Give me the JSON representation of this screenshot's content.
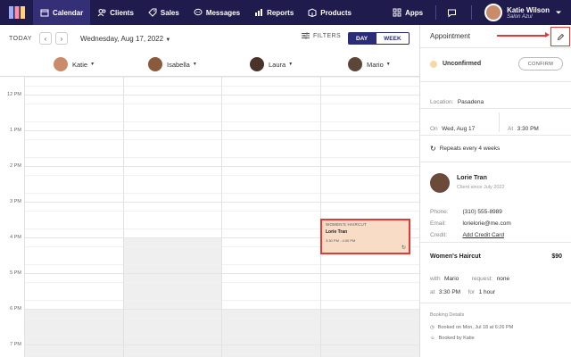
{
  "nav": {
    "items": [
      {
        "label": "Calendar",
        "icon": "calendar-icon"
      },
      {
        "label": "Clients",
        "icon": "clients-icon"
      },
      {
        "label": "Sales",
        "icon": "tag-icon"
      },
      {
        "label": "Messages",
        "icon": "chat-icon"
      },
      {
        "label": "Reports",
        "icon": "chart-icon"
      },
      {
        "label": "Products",
        "icon": "box-icon"
      }
    ],
    "apps_label": "Apps",
    "user_name": "Katie Wilson",
    "user_salon": "Salon Azul"
  },
  "toolbar": {
    "today_label": "TODAY",
    "date_label": "Wednesday, Aug 17, 2022",
    "filters_label": "FILTERS",
    "day_label": "DAY",
    "week_label": "WEEK"
  },
  "staff": [
    {
      "name": "Katie",
      "color": "#c98b6a"
    },
    {
      "name": "Isabella",
      "color": "#8a5a3c"
    },
    {
      "name": "Laura",
      "color": "#4a3328"
    },
    {
      "name": "Mario",
      "color": "#5b4638"
    }
  ],
  "hours": [
    "12 PM",
    "1 PM",
    "2 PM",
    "3 PM",
    "4 PM",
    "5 PM",
    "6 PM",
    "7 PM"
  ],
  "appointment_card": {
    "service": "WOMEN'S HAIRCUT",
    "client": "Lorie Tran",
    "time": "3:30 PM - 4:30 PM"
  },
  "panel": {
    "title": "Appointment",
    "status": "Unconfirmed",
    "confirm_label": "CONFIRM",
    "location_label": "Location:",
    "location_value": "Pasadena",
    "on_label": "On",
    "on_value": "Wed, Aug 17",
    "at_label": "At",
    "at_value": "3:30 PM",
    "repeat_text": "Repeats every 4 weeks",
    "client_name": "Lorie Tran",
    "client_since": "Client since July 2022",
    "phone_label": "Phone:",
    "phone_value": "(310) 555-8989",
    "email_label": "Email:",
    "email_value": "lorielorie@me.com",
    "credit_label": "Credit:",
    "credit_value": "Add Credit Card",
    "service_name": "Women's Haircut",
    "service_price": "$90",
    "with_label": "with",
    "with_value": "Mario",
    "request_label": "request:",
    "request_value": "none",
    "at2_label": "at",
    "at2_value": "3:30 PM",
    "for_label": "for",
    "for_value": "1 hour",
    "booking_details": "Booking Details",
    "booked_on": "Booked on Mon, Jul 18 at 6:26 PM",
    "booked_by": "Booked by Katie"
  },
  "colors": {
    "nav_bg": "#1f1b4d",
    "accent": "#2b2c77",
    "highlight": "#e53935",
    "appt_bg": "#f9dcc6",
    "unconfirmed_dot": "#f7d9a8"
  }
}
